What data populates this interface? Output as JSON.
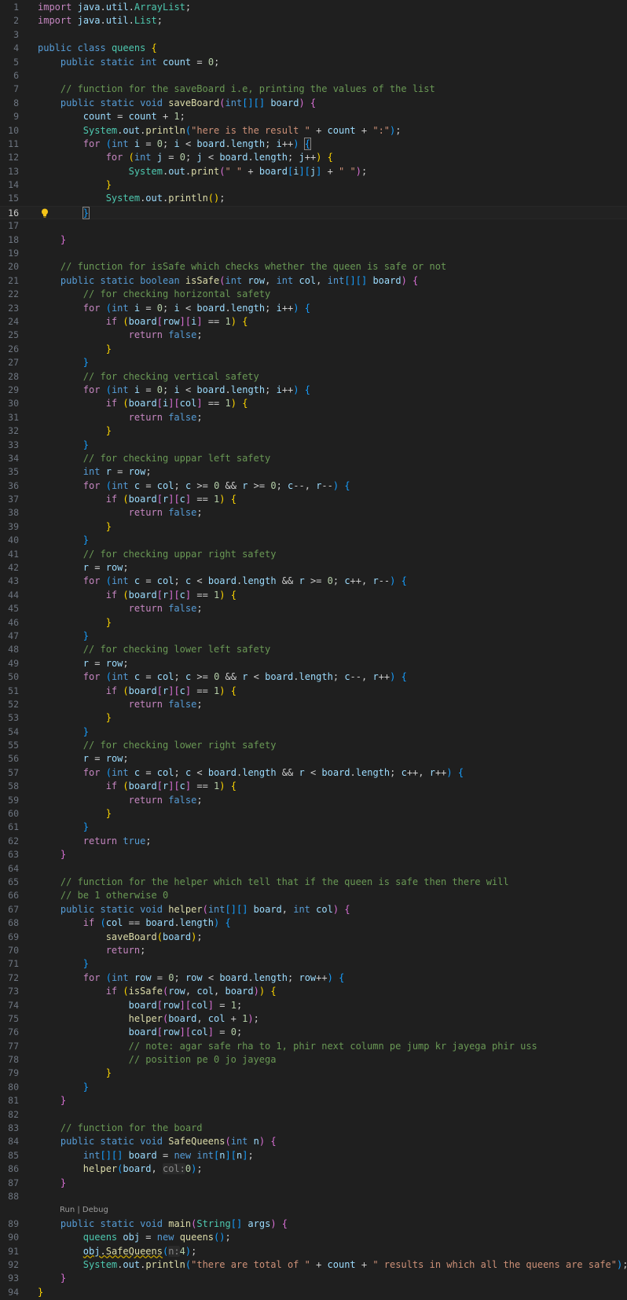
{
  "editor": {
    "language": "java",
    "current_line": 16,
    "codelens": {
      "label": "Run | Debug",
      "before_line": 89
    },
    "colors": {
      "background": "#1f1f1f",
      "keyword": "#569cd6",
      "control": "#c586c0",
      "type": "#4ec9b0",
      "function": "#dcdcaa",
      "variable": "#9cdcfe",
      "string": "#ce9178",
      "number": "#b5cea8",
      "comment": "#6a9955"
    },
    "lines": [
      {
        "n": "1",
        "html": "<span class='c'>import</span> <span class='v'>java</span>.<span class='v'>util</span>.<span class='t'>ArrayList</span>;"
      },
      {
        "n": "2",
        "html": "<span class='c'>import</span> <span class='v'>java</span>.<span class='v'>util</span>.<span class='t'>List</span>;"
      },
      {
        "n": "3",
        "html": ""
      },
      {
        "n": "4",
        "html": "<span class='k'>public</span> <span class='k'>class</span> <span class='t'>queens</span> <span class='b1'>{</span>"
      },
      {
        "n": "5",
        "html": "    <span class='k'>public</span> <span class='k'>static</span> <span class='k'>int</span> <span class='v'>count</span> = <span class='n'>0</span>;"
      },
      {
        "n": "6",
        "html": ""
      },
      {
        "n": "7",
        "html": "    <span class='m'>// function for the saveBoard i.e, printing the values of the list</span>"
      },
      {
        "n": "8",
        "html": "    <span class='k'>public</span> <span class='k'>static</span> <span class='k'>void</span> <span class='f'>saveBoard</span><span class='b2'>(</span><span class='k'>int</span><span class='b3'>[][]</span> <span class='v'>board</span><span class='b2'>)</span> <span class='b2'>{</span>"
      },
      {
        "n": "9",
        "html": "        <span class='v'>count</span> = <span class='v'>count</span> + <span class='n'>1</span>;"
      },
      {
        "n": "10",
        "html": "        <span class='t'>System</span>.<span class='v'>out</span>.<span class='f'>println</span><span class='b3'>(</span><span class='s'>\"here is the result \"</span> + <span class='v'>count</span> + <span class='s'>\":\"</span><span class='b3'>)</span>;"
      },
      {
        "n": "11",
        "html": "        <span class='c'>for</span> <span class='b3'>(</span><span class='k'>int</span> <span class='v'>i</span> = <span class='n'>0</span>; <span class='v'>i</span> &lt; <span class='v'>board</span>.<span class='v'>length</span>; <span class='v'>i</span>++<span class='b3'>)</span> <span class='b3 bracket-hl'>{</span>"
      },
      {
        "n": "12",
        "html": "            <span class='c'>for</span> <span class='b1'>(</span><span class='k'>int</span> <span class='v'>j</span> = <span class='n'>0</span>; <span class='v'>j</span> &lt; <span class='v'>board</span>.<span class='v'>length</span>; <span class='v'>j</span>++<span class='b1'>)</span> <span class='b1'>{</span>"
      },
      {
        "n": "13",
        "html": "                <span class='t'>System</span>.<span class='v'>out</span>.<span class='f'>print</span><span class='b2'>(</span><span class='s'>\" \"</span> + <span class='v'>board</span><span class='b3'>[</span><span class='v'>i</span><span class='b3'>][</span><span class='v'>j</span><span class='b3'>]</span> + <span class='s'>\" \"</span><span class='b2'>)</span>;"
      },
      {
        "n": "14",
        "html": "            <span class='b1'>}</span>"
      },
      {
        "n": "15",
        "html": "            <span class='t'>System</span>.<span class='v'>out</span>.<span class='f'>println</span><span class='b1'>()</span>;"
      },
      {
        "n": "16",
        "html": "        <span class='b3 bracket-hl'>}</span><span class='caret'></span>"
      },
      {
        "n": "17",
        "html": ""
      },
      {
        "n": "18",
        "html": "    <span class='b2'>}</span>"
      },
      {
        "n": "19",
        "html": ""
      },
      {
        "n": "20",
        "html": "    <span class='m'>// function for isSafe which checks whether the queen is safe or not</span>"
      },
      {
        "n": "21",
        "html": "    <span class='k'>public</span> <span class='k'>static</span> <span class='k'>boolean</span> <span class='f'>isSafe</span><span class='b2'>(</span><span class='k'>int</span> <span class='v'>row</span>, <span class='k'>int</span> <span class='v'>col</span>, <span class='k'>int</span><span class='b3'>[][]</span> <span class='v'>board</span><span class='b2'>)</span> <span class='b2'>{</span>"
      },
      {
        "n": "22",
        "html": "        <span class='m'>// for checking horizontal safety</span>"
      },
      {
        "n": "23",
        "html": "        <span class='c'>for</span> <span class='b3'>(</span><span class='k'>int</span> <span class='v'>i</span> = <span class='n'>0</span>; <span class='v'>i</span> &lt; <span class='v'>board</span>.<span class='v'>length</span>; <span class='v'>i</span>++<span class='b3'>)</span> <span class='b3'>{</span>"
      },
      {
        "n": "24",
        "html": "            <span class='c'>if</span> <span class='b1'>(</span><span class='v'>board</span><span class='b2'>[</span><span class='v'>row</span><span class='b2'>][</span><span class='v'>i</span><span class='b2'>]</span> == <span class='n'>1</span><span class='b1'>)</span> <span class='b1'>{</span>"
      },
      {
        "n": "25",
        "html": "                <span class='c'>return</span> <span class='k'>false</span>;"
      },
      {
        "n": "26",
        "html": "            <span class='b1'>}</span>"
      },
      {
        "n": "27",
        "html": "        <span class='b3'>}</span>"
      },
      {
        "n": "28",
        "html": "        <span class='m'>// for checking vertical safety</span>"
      },
      {
        "n": "29",
        "html": "        <span class='c'>for</span> <span class='b3'>(</span><span class='k'>int</span> <span class='v'>i</span> = <span class='n'>0</span>; <span class='v'>i</span> &lt; <span class='v'>board</span>.<span class='v'>length</span>; <span class='v'>i</span>++<span class='b3'>)</span> <span class='b3'>{</span>"
      },
      {
        "n": "30",
        "html": "            <span class='c'>if</span> <span class='b1'>(</span><span class='v'>board</span><span class='b2'>[</span><span class='v'>i</span><span class='b2'>][</span><span class='v'>col</span><span class='b2'>]</span> == <span class='n'>1</span><span class='b1'>)</span> <span class='b1'>{</span>"
      },
      {
        "n": "31",
        "html": "                <span class='c'>return</span> <span class='k'>false</span>;"
      },
      {
        "n": "32",
        "html": "            <span class='b1'>}</span>"
      },
      {
        "n": "33",
        "html": "        <span class='b3'>}</span>"
      },
      {
        "n": "34",
        "html": "        <span class='m'>// for checking uppar left safety</span>"
      },
      {
        "n": "35",
        "html": "        <span class='k'>int</span> <span class='v'>r</span> = <span class='v'>row</span>;"
      },
      {
        "n": "36",
        "html": "        <span class='c'>for</span> <span class='b3'>(</span><span class='k'>int</span> <span class='v'>c</span> = <span class='v'>col</span>; <span class='v'>c</span> &gt;= <span class='n'>0</span> &amp;&amp; <span class='v'>r</span> &gt;= <span class='n'>0</span>; <span class='v'>c</span>--, <span class='v'>r</span>--<span class='b3'>)</span> <span class='b3'>{</span>"
      },
      {
        "n": "37",
        "html": "            <span class='c'>if</span> <span class='b1'>(</span><span class='v'>board</span><span class='b2'>[</span><span class='v'>r</span><span class='b2'>][</span><span class='v'>c</span><span class='b2'>]</span> == <span class='n'>1</span><span class='b1'>)</span> <span class='b1'>{</span>"
      },
      {
        "n": "38",
        "html": "                <span class='c'>return</span> <span class='k'>false</span>;"
      },
      {
        "n": "39",
        "html": "            <span class='b1'>}</span>"
      },
      {
        "n": "40",
        "html": "        <span class='b3'>}</span>"
      },
      {
        "n": "41",
        "html": "        <span class='m'>// for checking uppar right safety</span>"
      },
      {
        "n": "42",
        "html": "        <span class='v'>r</span> = <span class='v'>row</span>;"
      },
      {
        "n": "43",
        "html": "        <span class='c'>for</span> <span class='b3'>(</span><span class='k'>int</span> <span class='v'>c</span> = <span class='v'>col</span>; <span class='v'>c</span> &lt; <span class='v'>board</span>.<span class='v'>length</span> &amp;&amp; <span class='v'>r</span> &gt;= <span class='n'>0</span>; <span class='v'>c</span>++, <span class='v'>r</span>--<span class='b3'>)</span> <span class='b3'>{</span>"
      },
      {
        "n": "44",
        "html": "            <span class='c'>if</span> <span class='b1'>(</span><span class='v'>board</span><span class='b2'>[</span><span class='v'>r</span><span class='b2'>][</span><span class='v'>c</span><span class='b2'>]</span> == <span class='n'>1</span><span class='b1'>)</span> <span class='b1'>{</span>"
      },
      {
        "n": "45",
        "html": "                <span class='c'>return</span> <span class='k'>false</span>;"
      },
      {
        "n": "46",
        "html": "            <span class='b1'>}</span>"
      },
      {
        "n": "47",
        "html": "        <span class='b3'>}</span>"
      },
      {
        "n": "48",
        "html": "        <span class='m'>// for checking lower left safety</span>"
      },
      {
        "n": "49",
        "html": "        <span class='v'>r</span> = <span class='v'>row</span>;"
      },
      {
        "n": "50",
        "html": "        <span class='c'>for</span> <span class='b3'>(</span><span class='k'>int</span> <span class='v'>c</span> = <span class='v'>col</span>; <span class='v'>c</span> &gt;= <span class='n'>0</span> &amp;&amp; <span class='v'>r</span> &lt; <span class='v'>board</span>.<span class='v'>length</span>; <span class='v'>c</span>--, <span class='v'>r</span>++<span class='b3'>)</span> <span class='b3'>{</span>"
      },
      {
        "n": "51",
        "html": "            <span class='c'>if</span> <span class='b1'>(</span><span class='v'>board</span><span class='b2'>[</span><span class='v'>r</span><span class='b2'>][</span><span class='v'>c</span><span class='b2'>]</span> == <span class='n'>1</span><span class='b1'>)</span> <span class='b1'>{</span>"
      },
      {
        "n": "52",
        "html": "                <span class='c'>return</span> <span class='k'>false</span>;"
      },
      {
        "n": "53",
        "html": "            <span class='b1'>}</span>"
      },
      {
        "n": "54",
        "html": "        <span class='b3'>}</span>"
      },
      {
        "n": "55",
        "html": "        <span class='m'>// for checking lower right safety</span>"
      },
      {
        "n": "56",
        "html": "        <span class='v'>r</span> = <span class='v'>row</span>;"
      },
      {
        "n": "57",
        "html": "        <span class='c'>for</span> <span class='b3'>(</span><span class='k'>int</span> <span class='v'>c</span> = <span class='v'>col</span>; <span class='v'>c</span> &lt; <span class='v'>board</span>.<span class='v'>length</span> &amp;&amp; <span class='v'>r</span> &lt; <span class='v'>board</span>.<span class='v'>length</span>; <span class='v'>c</span>++, <span class='v'>r</span>++<span class='b3'>)</span> <span class='b3'>{</span>"
      },
      {
        "n": "58",
        "html": "            <span class='c'>if</span> <span class='b1'>(</span><span class='v'>board</span><span class='b2'>[</span><span class='v'>r</span><span class='b2'>][</span><span class='v'>c</span><span class='b2'>]</span> == <span class='n'>1</span><span class='b1'>)</span> <span class='b1'>{</span>"
      },
      {
        "n": "59",
        "html": "                <span class='c'>return</span> <span class='k'>false</span>;"
      },
      {
        "n": "60",
        "html": "            <span class='b1'>}</span>"
      },
      {
        "n": "61",
        "html": "        <span class='b3'>}</span>"
      },
      {
        "n": "62",
        "html": "        <span class='c'>return</span> <span class='k'>true</span>;"
      },
      {
        "n": "63",
        "html": "    <span class='b2'>}</span>"
      },
      {
        "n": "64",
        "html": ""
      },
      {
        "n": "65",
        "html": "    <span class='m'>// function for the helper which tell that if the queen is safe then there will</span>"
      },
      {
        "n": "66",
        "html": "    <span class='m'>// be 1 otherwise 0</span>"
      },
      {
        "n": "67",
        "html": "    <span class='k'>public</span> <span class='k'>static</span> <span class='k'>void</span> <span class='f'>helper</span><span class='b2'>(</span><span class='k'>int</span><span class='b3'>[][]</span> <span class='v'>board</span>, <span class='k'>int</span> <span class='v'>col</span><span class='b2'>)</span> <span class='b2'>{</span>"
      },
      {
        "n": "68",
        "html": "        <span class='c'>if</span> <span class='b3'>(</span><span class='v'>col</span> == <span class='v'>board</span>.<span class='v'>length</span><span class='b3'>)</span> <span class='b3'>{</span>"
      },
      {
        "n": "69",
        "html": "            <span class='f'>saveBoard</span><span class='b1'>(</span><span class='v'>board</span><span class='b1'>)</span>;"
      },
      {
        "n": "70",
        "html": "            <span class='c'>return</span>;"
      },
      {
        "n": "71",
        "html": "        <span class='b3'>}</span>"
      },
      {
        "n": "72",
        "html": "        <span class='c'>for</span> <span class='b3'>(</span><span class='k'>int</span> <span class='v'>row</span> = <span class='n'>0</span>; <span class='v'>row</span> &lt; <span class='v'>board</span>.<span class='v'>length</span>; <span class='v'>row</span>++<span class='b3'>)</span> <span class='b3'>{</span>"
      },
      {
        "n": "73",
        "html": "            <span class='c'>if</span> <span class='b1'>(</span><span class='f'>isSafe</span><span class='b2'>(</span><span class='v'>row</span>, <span class='v'>col</span>, <span class='v'>board</span><span class='b2'>)</span><span class='b1'>)</span> <span class='b1'>{</span>"
      },
      {
        "n": "74",
        "html": "                <span class='v'>board</span><span class='b2'>[</span><span class='v'>row</span><span class='b2'>][</span><span class='v'>col</span><span class='b2'>]</span> = <span class='n'>1</span>;"
      },
      {
        "n": "75",
        "html": "                <span class='f'>helper</span><span class='b2'>(</span><span class='v'>board</span>, <span class='v'>col</span> + <span class='n'>1</span><span class='b2'>)</span>;"
      },
      {
        "n": "76",
        "html": "                <span class='v'>board</span><span class='b2'>[</span><span class='v'>row</span><span class='b2'>][</span><span class='v'>col</span><span class='b2'>]</span> = <span class='n'>0</span>;"
      },
      {
        "n": "77",
        "html": "                <span class='m'>// note: agar safe rha to 1, phir next column pe jump kr jayega phir uss</span>"
      },
      {
        "n": "78",
        "html": "                <span class='m'>// position pe 0 jo jayega</span>"
      },
      {
        "n": "79",
        "html": "            <span class='b1'>}</span>"
      },
      {
        "n": "80",
        "html": "        <span class='b3'>}</span>"
      },
      {
        "n": "81",
        "html": "    <span class='b2'>}</span>"
      },
      {
        "n": "82",
        "html": ""
      },
      {
        "n": "83",
        "html": "    <span class='m'>// function for the board</span>"
      },
      {
        "n": "84",
        "html": "    <span class='k'>public</span> <span class='k'>static</span> <span class='k'>void</span> <span class='f'>SafeQueens</span><span class='b2'>(</span><span class='k'>int</span> <span class='v'>n</span><span class='b2'>)</span> <span class='b2'>{</span>"
      },
      {
        "n": "85",
        "html": "        <span class='k'>int</span><span class='b3'>[][]</span> <span class='v'>board</span> = <span class='k'>new</span> <span class='k'>int</span><span class='b3'>[</span><span class='v'>n</span><span class='b3'>][</span><span class='v'>n</span><span class='b3'>]</span>;"
      },
      {
        "n": "86",
        "html": "        <span class='f'>helper</span><span class='b3'>(</span><span class='v'>board</span>, <span class='hint'>col:</span><span class='n'>0</span><span class='b3'>)</span>;"
      },
      {
        "n": "87",
        "html": "    <span class='b2'>}</span>"
      },
      {
        "n": "88",
        "html": ""
      },
      {
        "n": "89",
        "html": "    <span class='k'>public</span> <span class='k'>static</span> <span class='k'>void</span> <span class='f'>main</span><span class='b2'>(</span><span class='t'>String</span><span class='b3'>[]</span> <span class='v'>args</span><span class='b2'>)</span> <span class='b2'>{</span>"
      },
      {
        "n": "90",
        "html": "        <span class='t'>queens</span> <span class='v'>obj</span> = <span class='k'>new</span> <span class='f'>queens</span><span class='b3'>()</span>;"
      },
      {
        "n": "91",
        "html": "        <span class='v squig'>obj</span><span class='squig'>.</span><span class='f squig'>SafeQueens</span><span class='b3'>(</span><span class='hint'>n:</span><span class='n'>4</span><span class='b3'>)</span>;"
      },
      {
        "n": "92",
        "html": "        <span class='t'>System</span>.<span class='v'>out</span>.<span class='f'>println</span><span class='b3'>(</span><span class='s'>\"there are total of \"</span> + <span class='v'>count</span> + <span class='s'>\" results in which all the queens are safe\"</span><span class='b3'>)</span>;"
      },
      {
        "n": "93",
        "html": "    <span class='b2'>}</span>"
      },
      {
        "n": "94",
        "html": "<span class='b1'>}</span>"
      }
    ]
  }
}
